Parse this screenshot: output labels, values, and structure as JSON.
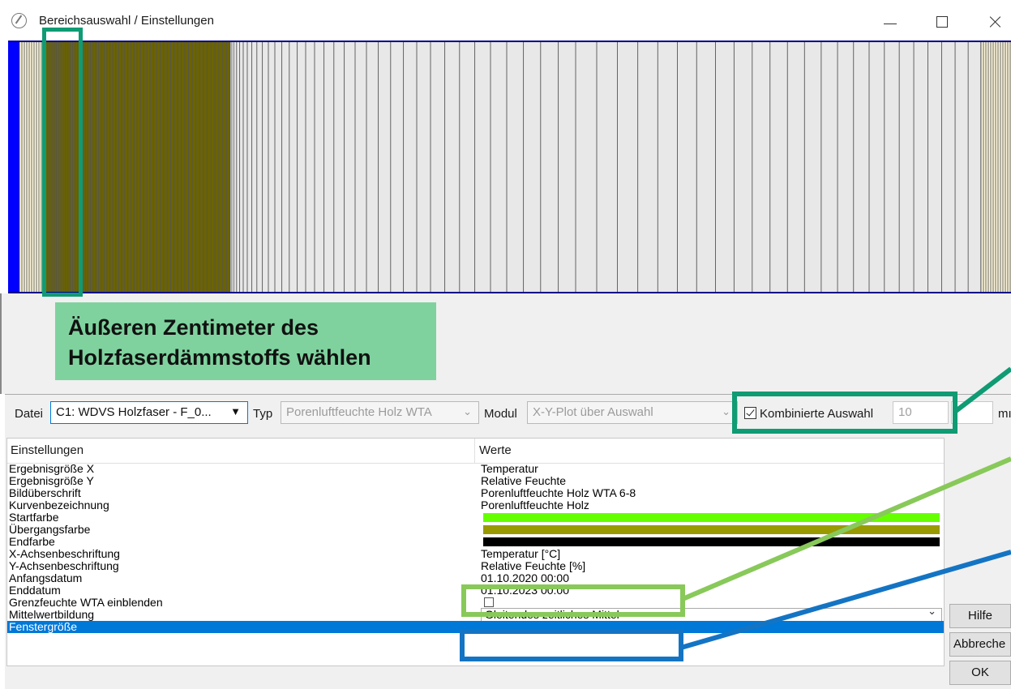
{
  "window": {
    "title": "Bereichsauswahl / Einstellungen",
    "controls": [
      "minimize",
      "maximize",
      "close"
    ]
  },
  "annotations": {
    "main_label": "Äußeren Zentimeter des Holzfaserdämmstoffs wählen",
    "colors": {
      "teal": "#0f9b73",
      "light_green": "#88c95a",
      "blue": "#1474c4",
      "label_bg": "#7fd29e"
    }
  },
  "layer_strip": {
    "colors": {
      "outer": "#0000ff",
      "render": "#fff8dc",
      "holzfaser": "#6b6300",
      "insulation": "#e8e8e8",
      "border": "#00008b"
    }
  },
  "toolbar": {
    "datei_label": "Datei",
    "datei_value": "C1: WDVS Holzfaser - F_0...",
    "typ_label": "Typ",
    "typ_value": "Porenluftfeuchte Holz WTA",
    "modul_label": "Modul",
    "modul_value": "X-Y-Plot über Auswahl",
    "kombinierte_label": "Kombinierte Auswahl",
    "kombinierte_checked": true,
    "kombinierte_value": "10",
    "unit_truncated": "mı"
  },
  "settings_table": {
    "headers": [
      "Einstellungen",
      "Werte"
    ],
    "rows": [
      {
        "key": "Ergebnisgröße X",
        "value": "Temperatur"
      },
      {
        "key": "Ergebnisgröße Y",
        "value": "Relative Feuchte"
      },
      {
        "key": "Bildüberschrift",
        "value": "Porenluftfeuchte Holz WTA 6-8"
      },
      {
        "key": "Kurvenbezeichnung",
        "value": "Porenluftfeuchte Holz"
      },
      {
        "key": "Startfarbe",
        "value": "",
        "color": "#66ff00"
      },
      {
        "key": "Übergangsfarbe",
        "value": "",
        "color": "#999900"
      },
      {
        "key": "Endfarbe",
        "value": "",
        "color": "#000000"
      },
      {
        "key": "X-Achsenbeschriftung",
        "value": "Temperatur [°C]"
      },
      {
        "key": "Y-Achsenbeschriftung",
        "value": "Relative Feuchte [%]"
      },
      {
        "key": "Anfangsdatum",
        "value": "01.10.2020 00:00"
      },
      {
        "key": "Enddatum",
        "value": "01.10.2023 00:00"
      },
      {
        "key": "Grenzfeuchte WTA einblenden",
        "value": "",
        "checkbox": true
      },
      {
        "key": "Mittelwertbildung",
        "value": "Gleitendes zeitliches Mittel"
      },
      {
        "key": "Fenstergröße",
        "value": ""
      }
    ],
    "selected_row": "Fenstergröße"
  },
  "buttons": {
    "hilfe": "Hilfe",
    "abbrechen": "Abbreche",
    "ok": "OK"
  }
}
